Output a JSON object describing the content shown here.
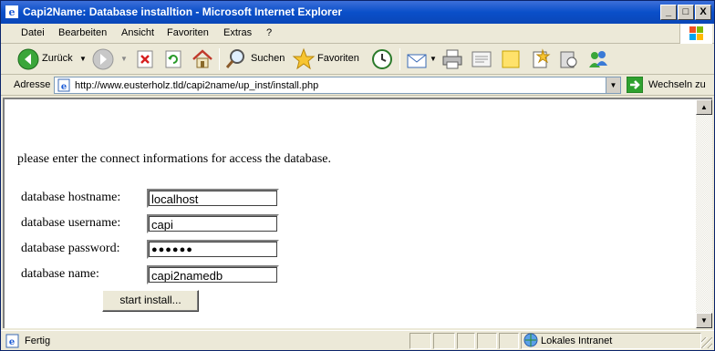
{
  "window": {
    "title": "Capi2Name: Database installtion - Microsoft Internet Explorer",
    "minimize": "_",
    "maximize": "□",
    "close": "X"
  },
  "menu": {
    "items": [
      {
        "label": "Datei"
      },
      {
        "label": "Bearbeiten"
      },
      {
        "label": "Ansicht"
      },
      {
        "label": "Favoriten"
      },
      {
        "label": "Extras"
      },
      {
        "label": "?"
      }
    ]
  },
  "toolbar": {
    "back_label": "Zurück",
    "search_label": "Suchen",
    "favorites_label": "Favoriten"
  },
  "address": {
    "label": "Adresse",
    "url": "http://www.eusterholz.tld/capi2name/up_inst/install.php",
    "go_label": "Wechseln zu"
  },
  "page": {
    "intro": "please enter the connect informations for access the database.",
    "fields": [
      {
        "label": "database hostname:",
        "value": "localhost"
      },
      {
        "label": "database username:",
        "value": "capi"
      },
      {
        "label": "database password:",
        "value": "●●●●●●"
      },
      {
        "label": "database name:",
        "value": "capi2namedb"
      }
    ],
    "submit_label": "start install..."
  },
  "status": {
    "text": "Fertig",
    "zone": "Lokales Intranet"
  },
  "colors": {
    "titlebar": "#0a4fc9",
    "chrome": "#ece9d8"
  }
}
